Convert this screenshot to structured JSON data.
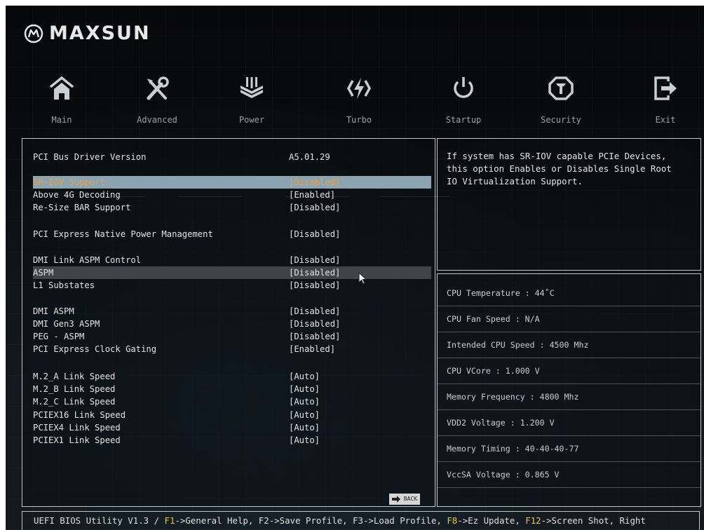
{
  "brand": {
    "name": "MAXSUN",
    "icon": "maxsun-logo-icon"
  },
  "tabs": [
    {
      "label": "Main",
      "icon": "home-icon"
    },
    {
      "label": "Advanced",
      "icon": "tools-icon"
    },
    {
      "label": "Power",
      "icon": "power-chip-icon"
    },
    {
      "label": "Turbo",
      "icon": "lightning-icon"
    },
    {
      "label": "Startup",
      "icon": "power-button-icon"
    },
    {
      "label": "Security",
      "icon": "shield-icon"
    },
    {
      "label": "Exit",
      "icon": "exit-icon"
    }
  ],
  "settings": {
    "bus_driver": {
      "label": "PCI Bus Driver Version",
      "value": "A5.01.29"
    },
    "sriov": {
      "label": "SR-IOV Support",
      "value": "[Disabled]"
    },
    "above4g": {
      "label": "Above 4G Decoding",
      "value": "[Enabled]"
    },
    "resize_bar": {
      "label": "Re-Size BAR Support",
      "value": "[Disabled]"
    },
    "pcie_native_pm": {
      "label": "PCI Express Native Power Management",
      "value": "[Disabled]"
    },
    "dmi_link_aspm": {
      "label": "DMI Link ASPM Control",
      "value": "[Disabled]"
    },
    "aspm": {
      "label": "ASPM",
      "value": "[Disabled]"
    },
    "l1_substates": {
      "label": "L1 Substates",
      "value": "[Disabled]"
    },
    "dmi_aspm": {
      "label": "DMI ASPM",
      "value": "[Disabled]"
    },
    "dmi_gen3_aspm": {
      "label": "DMI Gen3 ASPM",
      "value": "[Disabled]"
    },
    "peg_aspm": {
      "label": "PEG - ASPM",
      "value": "[Disabled]"
    },
    "pcie_clock_gating": {
      "label": "PCI Express Clock Gating",
      "value": "[Enabled]"
    },
    "m2a_speed": {
      "label": "M.2_A Link Speed",
      "value": "[Auto]"
    },
    "m2b_speed": {
      "label": "M.2_B Link Speed",
      "value": "[Auto]"
    },
    "m2c_speed": {
      "label": "M.2_C Link Speed",
      "value": "[Auto]"
    },
    "pciex16_speed": {
      "label": "PCIEX16 Link Speed",
      "value": "[Auto]"
    },
    "pciex4_speed": {
      "label": "PCIEX4 Link Speed",
      "value": "[Auto]"
    },
    "pciex1_speed": {
      "label": "PCIEX1 Link Speed",
      "value": "[Auto]"
    }
  },
  "back_label": "BACK",
  "help": "If system has SR-IOV capable PCIe Devices,\nthis option Enables or Disables Single Root\nIO Virtualization Support.",
  "status": {
    "cpu_temp": "CPU Temperature : 44˚C",
    "cpu_fan": "CPU Fan Speed : N/A",
    "intended_speed": "Intended CPU Speed : 4500 Mhz",
    "cpu_vcore": "CPU VCore : 1.000 V",
    "mem_freq": "Memory Frequency : 4800 Mhz",
    "vdd2": "VDD2 Voltage : 1.200 V",
    "mem_timing": "Memory Timing : 40-40-40-77",
    "vccsa": "VccSA Voltage : 0.865 V"
  },
  "footer": {
    "prefix": "UEFI BIOS Utility V1.3 / ",
    "f1": "F1",
    "f1_text": "->General Help, F2->Save Profile, F3->Load Profile, ",
    "f8": "F8",
    "f8_text": "->Ez Update, ",
    "f12": "F12",
    "f12_text": "->Screen Shot, Right"
  },
  "colors": {
    "selected_bg": "#8ba4b0",
    "selected_text": "#e5a050",
    "key_yellow": "#e5c84a"
  }
}
